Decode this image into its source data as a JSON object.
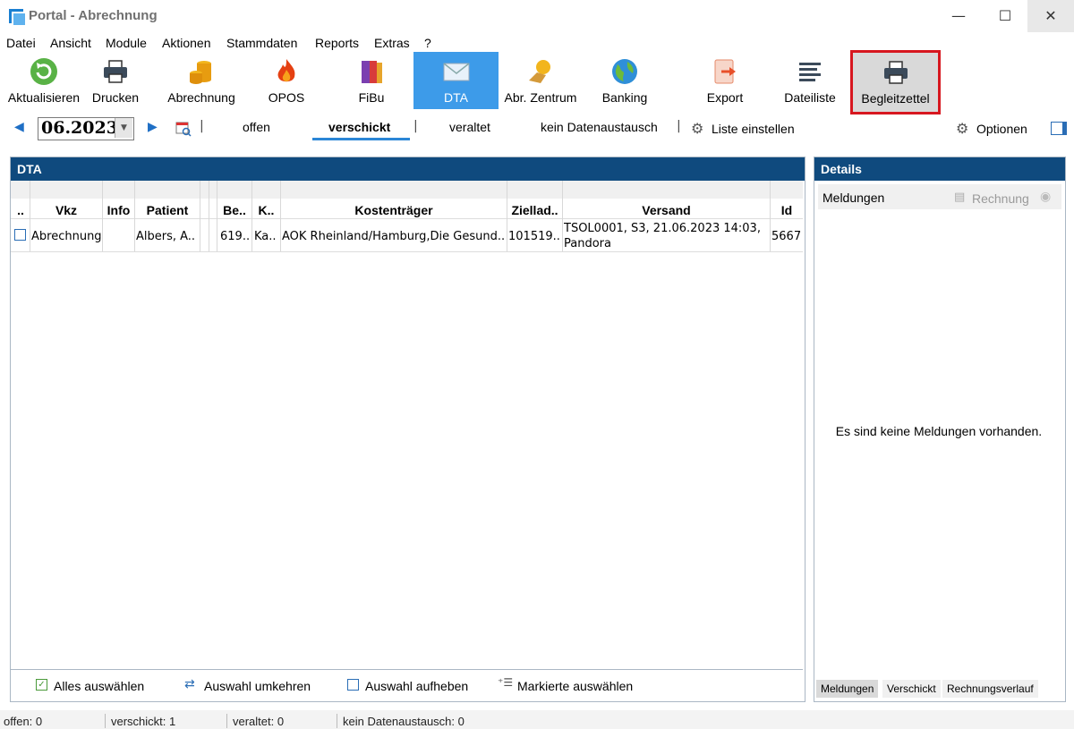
{
  "window": {
    "title": "Portal - Abrechnung",
    "minimize": "—",
    "maximize": "☐",
    "close": "✕"
  },
  "menu": [
    "Datei",
    "Ansicht",
    "Module",
    "Aktionen",
    "Stammdaten",
    "Reports",
    "Extras",
    "?"
  ],
  "toolbar": {
    "aktualisieren": "Aktualisieren",
    "drucken": "Drucken",
    "abrechnung": "Abrechnung",
    "opos": "OPOS",
    "fibu": "FiBu",
    "dta": "DTA",
    "abr_zentrum": "Abr. Zentrum",
    "banking": "Banking",
    "export": "Export",
    "dateiliste": "Dateiliste",
    "begleitzettel": "Begleitzettel"
  },
  "filter": {
    "period": "06.2023",
    "tabs": {
      "offen": "offen",
      "verschickt": "verschickt",
      "veraltet": "veraltet",
      "kein": "kein Datenaustausch"
    },
    "liste_einstellen": "Liste einstellen",
    "optionen": "Optionen",
    "sep": "|"
  },
  "dta": {
    "title": "DTA",
    "columns": {
      "sel": "..",
      "vkz": "Vkz",
      "info": "Info",
      "patient": "Patient",
      "be": "Be..",
      "k": "K..",
      "kostentraeger": "Kostenträger",
      "ziel": "Ziellad..",
      "versand": "Versand",
      "id": "Id"
    },
    "rows": [
      {
        "vkz": "Abrechnung",
        "info": "",
        "patient": "Albers, A..",
        "be": "619..",
        "k": "Ka..",
        "kostentraeger": "AOK Rheinland/Hamburg,Die Gesund..",
        "ziel": "101519..",
        "versand_1": "TSOL0001, S3, 21.06.2023 14:03,",
        "versand_2": "Pandora",
        "id": "5667"
      }
    ],
    "footer": {
      "alles": "Alles auswählen",
      "umkehren": "Auswahl umkehren",
      "aufheben": "Auswahl aufheben",
      "markierte": "Markierte auswählen"
    }
  },
  "details": {
    "title": "Details",
    "meldungen": "Meldungen",
    "rechnung": "Rechnung",
    "empty": "Es sind keine Meldungen vorhanden.",
    "tabs": {
      "meldungen": "Meldungen",
      "verschickt": "Verschickt",
      "verlauf": "Rechnungsverlauf"
    }
  },
  "status": {
    "offen": "offen: 0",
    "verschickt": "verschickt: 1",
    "veraltet": "veraltet: 0",
    "kein": "kein Datenaustausch: 0"
  },
  "colors": {
    "accent": "#3d9be9",
    "panel_header": "#0f4a7e",
    "highlight_border": "#d7171f"
  }
}
